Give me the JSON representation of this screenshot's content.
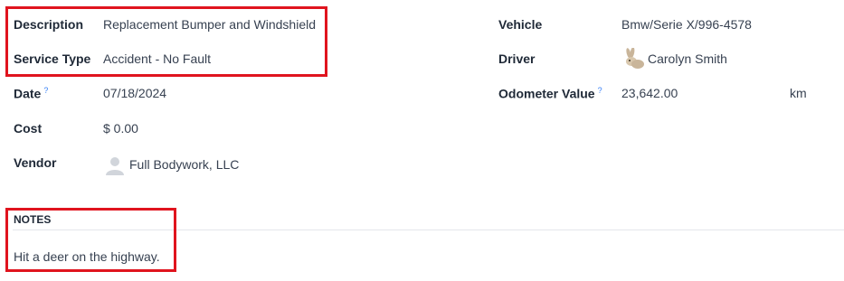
{
  "left_fields": {
    "description": {
      "label": "Description",
      "value": "Replacement Bumper and Windshield"
    },
    "service_type": {
      "label": "Service Type",
      "value": "Accident - No Fault"
    },
    "date": {
      "label": "Date",
      "help": "?",
      "value": "07/18/2024"
    },
    "cost": {
      "label": "Cost",
      "value": "$ 0.00"
    },
    "vendor": {
      "label": "Vendor",
      "value": "Full Bodywork, LLC",
      "avatar_icon": "user-placeholder-icon"
    }
  },
  "right_fields": {
    "vehicle": {
      "label": "Vehicle",
      "value": "Bmw/Serie X/996-4578"
    },
    "driver": {
      "label": "Driver",
      "value": "Carolyn Smith",
      "avatar_icon": "rabbit-avatar-icon"
    },
    "odometer": {
      "label": "Odometer Value",
      "help": "?",
      "value": "23,642.00",
      "unit": "km"
    }
  },
  "notes": {
    "heading": "NOTES",
    "text": "Hit a deer on the highway."
  },
  "colors": {
    "highlight": "#e0141e",
    "help": "#3b82f6",
    "label": "#1f2937",
    "value": "#374151"
  }
}
